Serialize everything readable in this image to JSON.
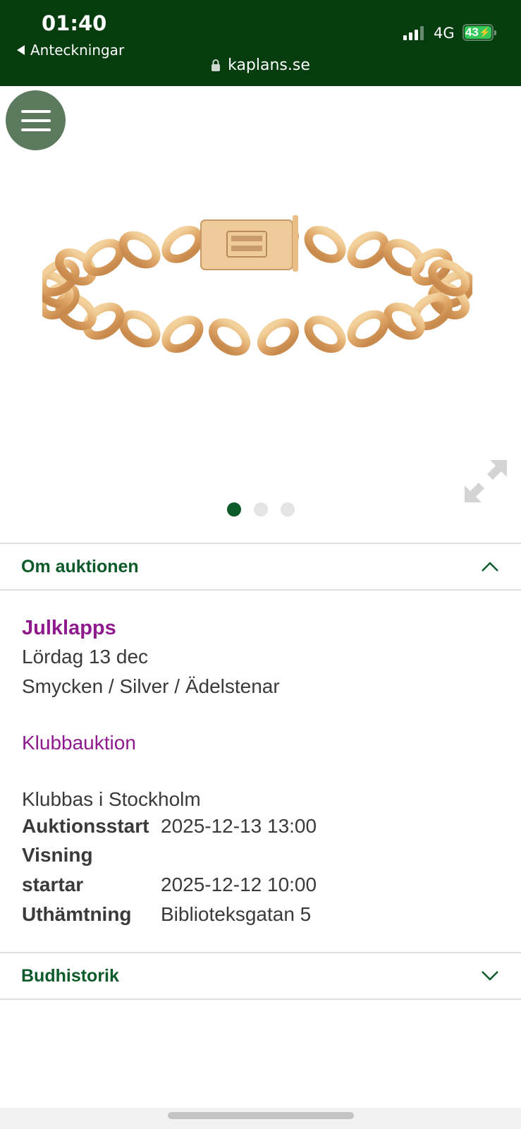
{
  "status_bar": {
    "time": "01:40",
    "back_label": "Anteckningar",
    "url": "kaplans.se",
    "network": "4G",
    "battery": "43",
    "background": "#053d0e"
  },
  "menu": {
    "icon": "hamburger-menu-icon"
  },
  "gallery": {
    "image_subject": "gold curb chain bracelet",
    "total_images": 3,
    "active_index": 0,
    "expand_icon": "expand-arrows-icon"
  },
  "about_section": {
    "title": "Om auktionen",
    "expanded": true,
    "auction_name": "Julklapps",
    "date": "Lördag 13 dec",
    "categories": "Smycken / Silver / Ädelstenar",
    "auction_type": "Klubbauktion",
    "location": "Klubbas i Stockholm",
    "rows": [
      {
        "label": "Auktionsstart",
        "value": "2025-12-13 13:00"
      },
      {
        "label": "Visning startar",
        "label_line1": "Visning",
        "label_line2": "startar",
        "value": "2025-12-12 10:00"
      },
      {
        "label": "Uthämtning",
        "value": "Biblioteksgatan 5"
      }
    ]
  },
  "bid_history_section": {
    "title": "Budhistorik",
    "expanded": false
  },
  "colors": {
    "accent_green": "#0d5a2b",
    "auction_purple": "#8e1a8e"
  }
}
